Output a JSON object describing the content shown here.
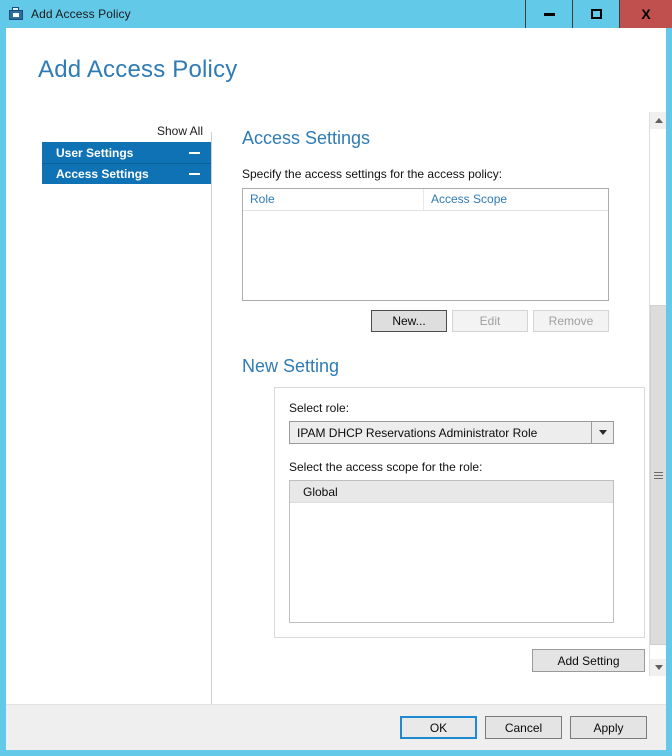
{
  "window": {
    "title": "Add Access Policy",
    "icon": "access-policy-icon",
    "buttons": {
      "minimize": "–",
      "maximize": "□",
      "close": "X"
    },
    "close_color": "#C0504D",
    "titlebar_color": "#62C9E8"
  },
  "page": {
    "heading": "Add Access Policy"
  },
  "nav": {
    "show_all": "Show All",
    "accent_color": "#0F72B5",
    "items": [
      {
        "label": "User Settings",
        "collapse_glyph": "minus"
      },
      {
        "label": "Access Settings",
        "collapse_glyph": "minus"
      }
    ]
  },
  "main": {
    "section_title": "Access Settings",
    "specify_label": "Specify the access settings for the access policy:",
    "list": {
      "columns": [
        "Role",
        "Access Scope"
      ],
      "rows": []
    },
    "list_buttons": [
      {
        "label": "New...",
        "state": "focused"
      },
      {
        "label": "Edit",
        "state": "disabled"
      },
      {
        "label": "Remove",
        "state": "disabled"
      }
    ],
    "new_setting": {
      "title": "New Setting",
      "role_label": "Select role:",
      "role_value": "IPAM DHCP Reservations Administrator Role",
      "scope_label": "Select the access scope for the role:",
      "scope_items": [
        "Global"
      ],
      "selected_scope": "Global",
      "add_button": "Add Setting"
    }
  },
  "footer": {
    "buttons": [
      {
        "label": "OK",
        "state": "default"
      },
      {
        "label": "Cancel",
        "state": "normal"
      },
      {
        "label": "Apply",
        "state": "normal"
      }
    ]
  }
}
